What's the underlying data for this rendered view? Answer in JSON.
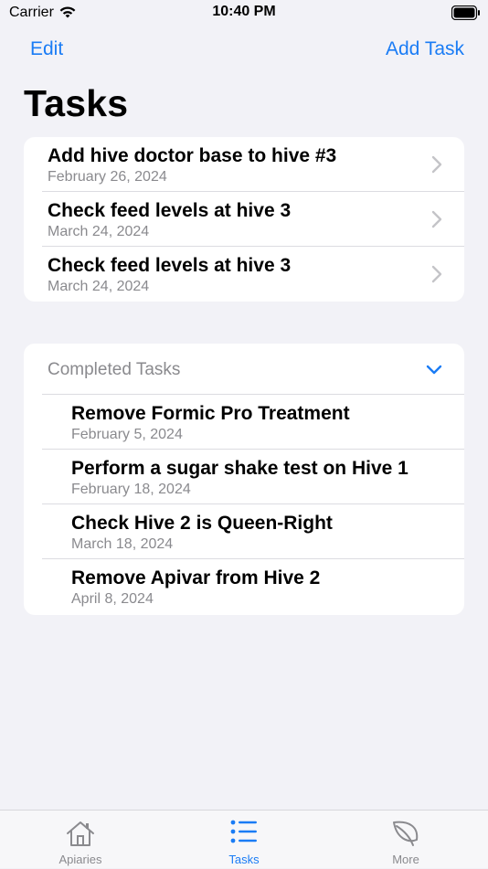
{
  "status_bar": {
    "carrier": "Carrier",
    "time": "10:40 PM"
  },
  "nav": {
    "edit_label": "Edit",
    "add_label": "Add Task"
  },
  "page_title": "Tasks",
  "tasks": [
    {
      "title": "Add hive doctor base to hive #3",
      "date": "February 26, 2024"
    },
    {
      "title": "Check feed levels at hive 3",
      "date": "March 24, 2024"
    },
    {
      "title": "Check feed levels at hive 3",
      "date": "March 24, 2024"
    }
  ],
  "completed": {
    "header": "Completed Tasks",
    "items": [
      {
        "title": "Remove Formic Pro Treatment",
        "date": "February 5, 2024"
      },
      {
        "title": "Perform a sugar shake test on Hive 1",
        "date": "February 18, 2024"
      },
      {
        "title": "Check Hive 2 is Queen-Right",
        "date": "March 18, 2024"
      },
      {
        "title": "Remove Apivar from Hive 2",
        "date": "April 8, 2024"
      }
    ]
  },
  "tabbar": {
    "tabs": [
      {
        "label": "Apiaries",
        "icon": "house-icon"
      },
      {
        "label": "Tasks",
        "icon": "list-icon",
        "active": true
      },
      {
        "label": "More",
        "icon": "leaf-icon"
      }
    ]
  },
  "colors": {
    "accent": "#1a7cf5",
    "background": "#f2f2f7",
    "secondary_text": "#8a8a8e"
  }
}
